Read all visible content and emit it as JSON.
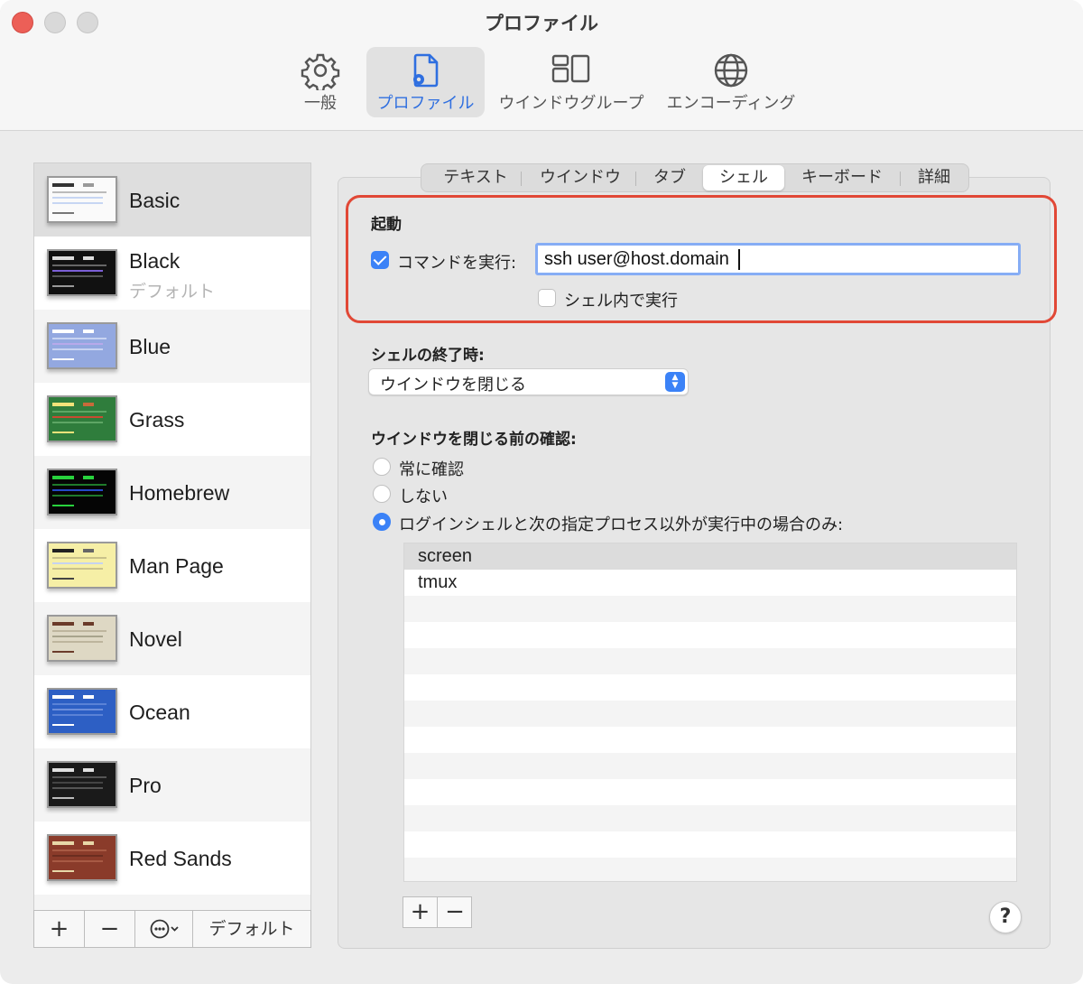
{
  "window": {
    "title": "プロファイル"
  },
  "toolbar": {
    "items": [
      {
        "label": "一般",
        "icon": "gear-icon"
      },
      {
        "label": "プロファイル",
        "icon": "profile-document-icon"
      },
      {
        "label": "ウインドウグループ",
        "icon": "window-groups-icon"
      },
      {
        "label": "エンコーディング",
        "icon": "globe-icon"
      }
    ],
    "selected": "プロファイル",
    "accent_color": "#2f6fe0"
  },
  "sidebar": {
    "profiles": [
      {
        "name": "Basic",
        "theme_bg": "#fafafa",
        "theme_fg": "#222222"
      },
      {
        "name": "Black",
        "subtitle": "デフォルト",
        "theme_bg": "#111111",
        "theme_fg": "#dddddd"
      },
      {
        "name": "Blue",
        "theme_bg": "#93a8e0",
        "theme_fg": "#ffffff"
      },
      {
        "name": "Grass",
        "theme_bg": "#2f7d3c",
        "theme_fg": "#f2e27a"
      },
      {
        "name": "Homebrew",
        "theme_bg": "#050505",
        "theme_fg": "#28d23d"
      },
      {
        "name": "Man Page",
        "theme_bg": "#f6efa6",
        "theme_fg": "#222222"
      },
      {
        "name": "Novel",
        "theme_bg": "#ded8c4",
        "theme_fg": "#6b3b2a"
      },
      {
        "name": "Ocean",
        "theme_bg": "#2d5fc4",
        "theme_fg": "#ffffff"
      },
      {
        "name": "Pro",
        "theme_bg": "#1a1a1a",
        "theme_fg": "#e0e0e0"
      },
      {
        "name": "Red Sands",
        "theme_bg": "#8a3b2a",
        "theme_fg": "#e8d8a8"
      }
    ],
    "selected": "Basic",
    "bottom": {
      "add": "+",
      "remove": "−",
      "more": "⋯",
      "default_label": "デフォルト"
    }
  },
  "tabs": [
    "テキスト",
    "ウインドウ",
    "タブ",
    "シェル",
    "キーボード",
    "詳細"
  ],
  "active_tab": "シェル",
  "startup": {
    "title": "起動",
    "run_command_label": "コマンドを実行:",
    "run_command_checked": true,
    "command_value": "ssh user@host.domain",
    "run_in_shell_label": "シェル内で実行",
    "run_in_shell_checked": false,
    "highlight_color": "#e14836"
  },
  "shell_exit": {
    "title": "シェルの終了時:",
    "selected_option": "ウインドウを閉じる"
  },
  "confirm_close": {
    "title": "ウインドウを閉じる前の確認:",
    "options": [
      "常に確認",
      "しない",
      "ログインシェルと次の指定プロセス以外が実行中の場合のみ:"
    ],
    "selected_index": 2,
    "processes": [
      "screen",
      "tmux"
    ],
    "add": "+",
    "remove": "−"
  },
  "help": "?",
  "accent_color": "#3b82f7"
}
